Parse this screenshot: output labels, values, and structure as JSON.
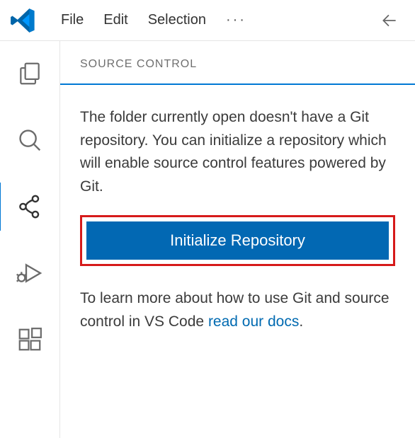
{
  "menubar": {
    "items": [
      "File",
      "Edit",
      "Selection"
    ],
    "overflow": "···"
  },
  "sidebar": {
    "title": "SOURCE CONTROL",
    "intro": "The folder currently open doesn't have a Git repository. You can initialize a repository which will enable source control features powered by Git.",
    "button_label": "Initialize Repository",
    "learn_prefix": "To learn more about how to use Git and source control in VS Code ",
    "learn_link": "read our docs",
    "learn_suffix": "."
  },
  "colors": {
    "accent": "#0078d4",
    "highlight": "#d61a1a"
  }
}
